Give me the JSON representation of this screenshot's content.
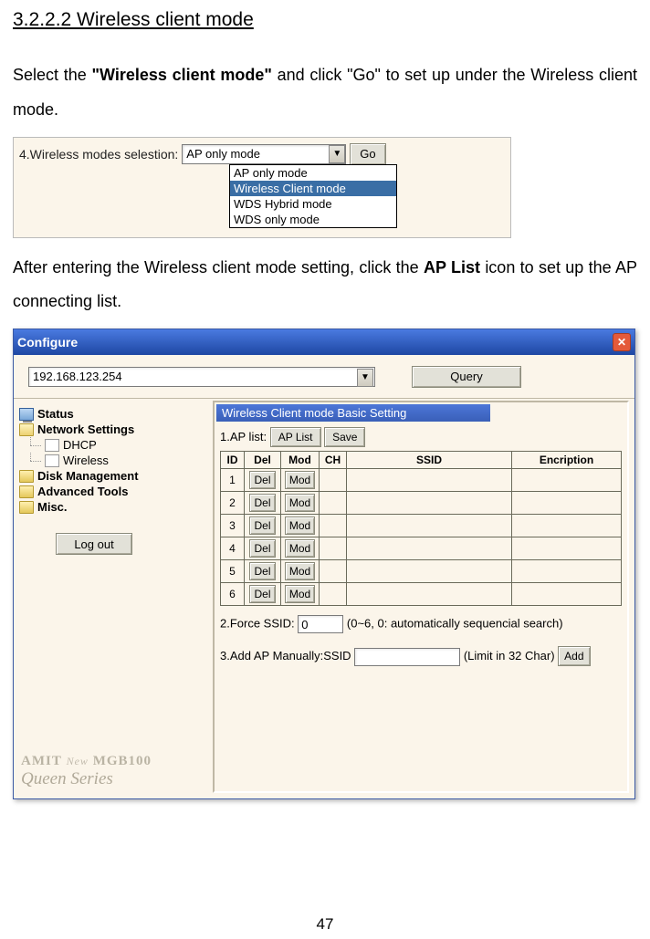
{
  "heading": "3.2.2.2 Wireless client mode",
  "para1_a": "Select the ",
  "para1_b": "\"Wireless client mode\"",
  "para1_c": " and click \"Go\" to set up under the Wireless client mode.",
  "para2_a": "After entering the Wireless client mode setting, click the ",
  "para2_b": "AP List",
  "para2_c": " icon to set up the AP connecting list.",
  "page_number": "47",
  "shot1": {
    "label": "4.Wireless modes selestion:",
    "selected": "AP only mode",
    "go": "Go",
    "options": [
      "AP only mode",
      "Wireless Client mode",
      "WDS Hybrid mode",
      "WDS only mode"
    ],
    "highlight_index": 1
  },
  "shot2": {
    "title": "Configure",
    "address": "192.168.123.254",
    "query": "Query",
    "sidebar": {
      "status": "Status",
      "network": "Network Settings",
      "dhcp": "DHCP",
      "wireless": "Wireless",
      "disk": "Disk Management",
      "adv": "Advanced Tools",
      "misc": "Misc.",
      "logout": "Log out"
    },
    "brand": {
      "l1a": "AMIT",
      "l1b": "New",
      "l1c": "MGB100",
      "l2": "Queen Series"
    },
    "main": {
      "section_title": "Wireless Client mode Basic Setting",
      "row1_label": "1.AP list:",
      "aplist_btn": "AP List",
      "save_btn": "Save",
      "headers": {
        "id": "ID",
        "del": "Del",
        "mod": "Mod",
        "ch": "CH",
        "ssid": "SSID",
        "enc": "Encription"
      },
      "del_label": "Del",
      "mod_label": "Mod",
      "ids": [
        "1",
        "2",
        "3",
        "4",
        "5",
        "6"
      ],
      "row2_label": "2.Force SSID:",
      "row2_value": "0",
      "row2_hint": "(0~6, 0: automatically sequencial search)",
      "row3_label": "3.Add AP Manually:SSID",
      "row3_hint": "(Limit in 32 Char)",
      "add_btn": "Add"
    }
  }
}
